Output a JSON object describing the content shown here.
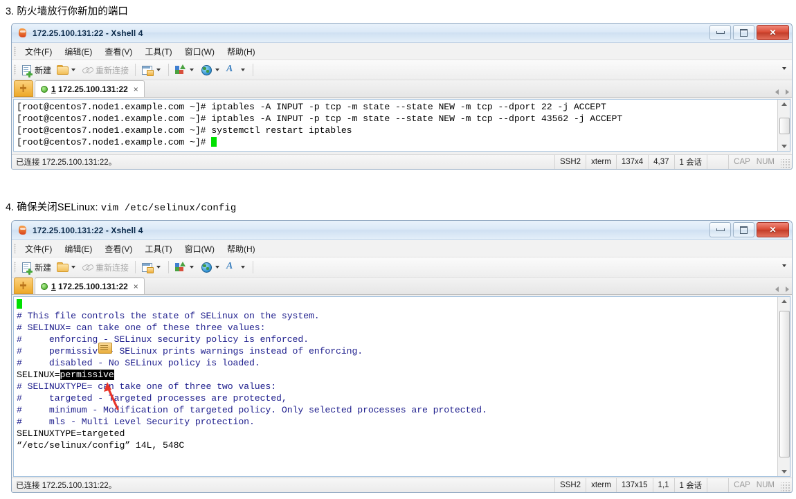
{
  "sections": [
    {
      "id": "section-3",
      "heading_prefix": "3. 防火墙放行你新加的端口",
      "heading_mono": ""
    },
    {
      "id": "section-4",
      "heading_prefix": "4. 确保关闭SELinux: ",
      "heading_mono": "vim /etc/selinux/config"
    }
  ],
  "window": {
    "title": "172.25.100.131:22 - Xshell 4",
    "icon": "xshell-logo-icon",
    "controls": {
      "minimize": "minimize-button",
      "maximize": "maximize-button",
      "close": "close-button"
    },
    "menu": [
      "文件(F)",
      "编辑(E)",
      "查看(V)",
      "工具(T)",
      "窗口(W)",
      "帮助(H)"
    ],
    "toolbar": [
      {
        "icon": "new-session-icon",
        "label": "新建",
        "dropdown": false,
        "disabled": false
      },
      {
        "icon": "open-folder-icon",
        "label": "",
        "dropdown": true,
        "disabled": false
      },
      {
        "icon": "reconnect-link-icon",
        "label": "重新连接",
        "dropdown": false,
        "disabled": true
      },
      {
        "icon": "session-properties-icon",
        "label": "",
        "dropdown": true,
        "disabled": false
      },
      {
        "icon": "file-transfer-icon",
        "label": "",
        "dropdown": true,
        "disabled": false
      },
      {
        "icon": "globe-icon",
        "label": "",
        "dropdown": true,
        "disabled": false
      },
      {
        "icon": "font-icon",
        "label": "",
        "dropdown": true,
        "disabled": false
      }
    ],
    "toolbar_overflow": "chevron-down-icon",
    "tab": {
      "number": "1",
      "label": "172.25.100.131:22",
      "close": "×",
      "status_dot_color": "#36a015"
    }
  },
  "window1": {
    "terminal_lines": [
      {
        "parts": [
          {
            "t": "[root@centos7.node1.example.com ~]# iptables -A INPUT -p tcp -m state --state NEW -m tcp --dport 22 -j ACCEPT"
          }
        ]
      },
      {
        "parts": [
          {
            "t": "[root@centos7.node1.example.com ~]# iptables -A INPUT -p tcp -m state --state NEW -m tcp --dport 43562 -j ACCEPT"
          }
        ]
      },
      {
        "parts": [
          {
            "t": "[root@centos7.node1.example.com ~]# systemctl restart iptables"
          }
        ]
      },
      {
        "parts": [
          {
            "t": "[root@centos7.node1.example.com ~]# "
          },
          {
            "t": "",
            "cursor": true
          }
        ]
      }
    ],
    "status": {
      "left": "已连接 172.25.100.131:22。",
      "cells": [
        "SSH2",
        "xterm",
        "137x4",
        "4,37",
        "1 会话"
      ],
      "indicators": [
        "CAP",
        "NUM"
      ]
    }
  },
  "window2": {
    "terminal_lines": [
      {
        "parts": [
          {
            "t": "",
            "cursor": true
          }
        ]
      },
      {
        "parts": [
          {
            "t": "# This file controls the state of SELinux on the system.",
            "blue": true
          }
        ]
      },
      {
        "parts": [
          {
            "t": "# SELINUX= can take one of these three values:",
            "blue": true
          }
        ]
      },
      {
        "parts": [
          {
            "t": "#     enforcing - SELinux security policy is enforced.",
            "blue": true
          }
        ]
      },
      {
        "parts": [
          {
            "t": "#     permissive - SELinux prints warnings instead of enforcing.",
            "blue": true
          }
        ]
      },
      {
        "parts": [
          {
            "t": "#     disabled - No SELinux policy is loaded.",
            "blue": true
          }
        ]
      },
      {
        "parts": [
          {
            "t": "SELINUX="
          },
          {
            "t": "permissive",
            "hl": true
          }
        ]
      },
      {
        "parts": [
          {
            "t": "# SELINUXTYPE= can take one of three two values:",
            "blue": true
          }
        ]
      },
      {
        "parts": [
          {
            "t": "#     targeted - Targeted processes are protected,",
            "blue": true
          }
        ]
      },
      {
        "parts": [
          {
            "t": "#     minimum - Modification of targeted policy. Only selected processes are protected.",
            "blue": true
          }
        ]
      },
      {
        "parts": [
          {
            "t": "#     mls - Multi Level Security protection.",
            "blue": true
          }
        ]
      },
      {
        "parts": [
          {
            "t": "SELINUXTYPE=targeted"
          }
        ]
      },
      {
        "parts": [
          {
            "t": ""
          }
        ]
      },
      {
        "parts": [
          {
            "t": ""
          }
        ]
      },
      {
        "parts": [
          {
            "t": "“/etc/selinux/config” 14L, 548C"
          }
        ]
      }
    ],
    "status": {
      "left": "已连接 172.25.100.131:22。",
      "cells": [
        "SSH2",
        "xterm",
        "137x15",
        "1,1",
        "1 会话"
      ],
      "indicators": [
        "CAP",
        "NUM"
      ]
    },
    "annotations": {
      "mouse_cursor": "resize-cursor-icon",
      "red_arrow": "red-arrow-annotation",
      "red_arrow_color": "#e8352a"
    }
  }
}
